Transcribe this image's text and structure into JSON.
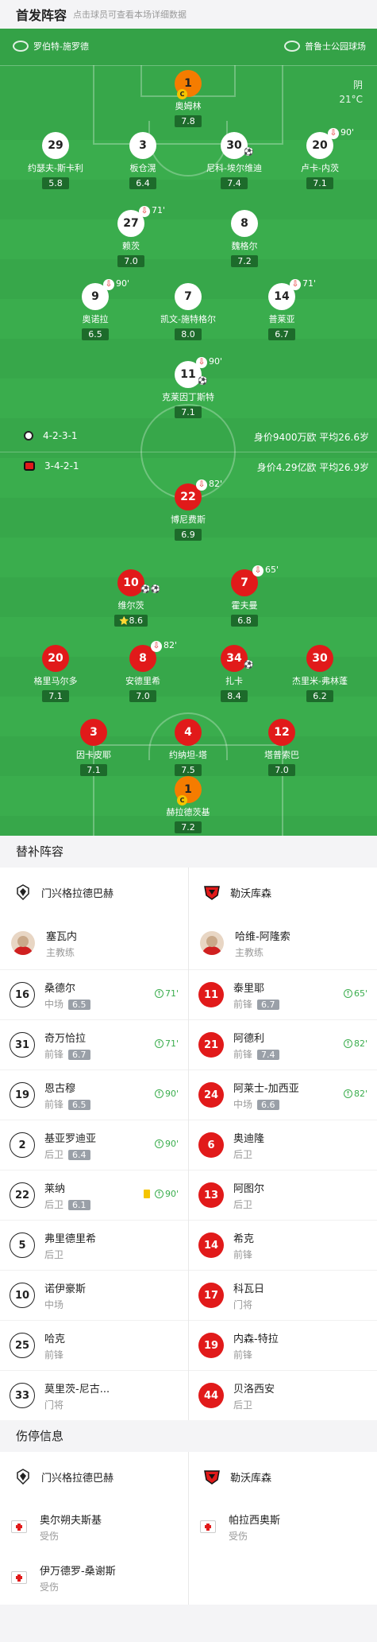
{
  "header": {
    "title": "首发阵容",
    "hint": "点击球员可查看本场详细数据"
  },
  "pitch": {
    "home_team": "罗伯特-施罗德",
    "venue": "普鲁士公园球场",
    "weather": "阴",
    "temperature": "21°C",
    "home_formation": "4-2-3-1",
    "home_info": "身价9400万欧 平均26.6岁",
    "away_formation": "3-4-2-1",
    "away_info": "身价4.29亿欧 平均26.9岁"
  },
  "players": [
    {
      "num": "1",
      "name": "奥姆林",
      "rating": "7.8",
      "style": "gk",
      "captain": "C"
    },
    {
      "num": "29",
      "name": "约瑟夫-斯卡利",
      "rating": "5.8",
      "style": "w"
    },
    {
      "num": "3",
      "name": "板仓滉",
      "rating": "6.4",
      "style": "w"
    },
    {
      "num": "30",
      "name": "尼科-埃尔维迪",
      "rating": "7.4",
      "style": "w",
      "ball": "⚽"
    },
    {
      "num": "20",
      "name": "卢卡-内茨",
      "rating": "7.1",
      "style": "w",
      "sub": "90'"
    },
    {
      "num": "27",
      "name": "赖茨",
      "rating": "7.0",
      "style": "w",
      "sub": "71'"
    },
    {
      "num": "8",
      "name": "魏格尔",
      "rating": "7.2",
      "style": "w"
    },
    {
      "num": "9",
      "name": "奥诺拉",
      "rating": "6.5",
      "style": "w",
      "sub": "90'"
    },
    {
      "num": "7",
      "name": "凯文-施特格尔",
      "rating": "8.0",
      "style": "w"
    },
    {
      "num": "14",
      "name": "普莱亚",
      "rating": "6.7",
      "style": "w",
      "sub": "71'"
    },
    {
      "num": "11",
      "name": "克莱因丁斯特",
      "rating": "7.1",
      "style": "w",
      "sub": "90'",
      "ball": "⚽"
    },
    {
      "num": "22",
      "name": "博尼费斯",
      "rating": "6.9",
      "style": "r",
      "sub": "82'"
    },
    {
      "num": "10",
      "name": "维尔茨",
      "rating": "8.6",
      "style": "r",
      "ball": "⚽⚽",
      "star": "⭐"
    },
    {
      "num": "7",
      "name": "霍夫曼",
      "rating": "6.8",
      "style": "r",
      "sub": "65'"
    },
    {
      "num": "20",
      "name": "格里马尔多",
      "rating": "7.1",
      "style": "r"
    },
    {
      "num": "8",
      "name": "安德里希",
      "rating": "7.0",
      "style": "r",
      "sub": "82'"
    },
    {
      "num": "34",
      "name": "扎卡",
      "rating": "8.4",
      "style": "r",
      "ball": "⚽"
    },
    {
      "num": "30",
      "name": "杰里米-弗林蓬",
      "rating": "6.2",
      "style": "r"
    },
    {
      "num": "3",
      "name": "因卡皮耶",
      "rating": "7.1",
      "style": "r"
    },
    {
      "num": "4",
      "name": "约纳坦-塔",
      "rating": "7.5",
      "style": "r"
    },
    {
      "num": "12",
      "name": "塔普索巴",
      "rating": "7.0",
      "style": "r"
    },
    {
      "num": "1",
      "name": "赫拉德茨基",
      "rating": "7.2",
      "style": "gk",
      "captain": "C"
    }
  ],
  "subs": {
    "title": "替补阵容",
    "home": {
      "team": "门兴格拉德巴赫",
      "coach": {
        "name": "塞瓦内",
        "role": "主教练"
      },
      "players": [
        {
          "num": "16",
          "name": "桑德尔",
          "pos": "中场",
          "rating": "6.5",
          "in": "71'"
        },
        {
          "num": "31",
          "name": "奇万恰拉",
          "pos": "前锋",
          "rating": "6.7",
          "in": "71'"
        },
        {
          "num": "19",
          "name": "恩古穆",
          "pos": "前锋",
          "rating": "6.5",
          "in": "90'"
        },
        {
          "num": "2",
          "name": "基亚罗迪亚",
          "pos": "后卫",
          "rating": "6.4",
          "in": "90'"
        },
        {
          "num": "22",
          "name": "莱纳",
          "pos": "后卫",
          "rating": "6.1",
          "in": "90'",
          "yellow": true
        },
        {
          "num": "5",
          "name": "弗里德里希",
          "pos": "后卫"
        },
        {
          "num": "10",
          "name": "诺伊豪斯",
          "pos": "中场"
        },
        {
          "num": "25",
          "name": "哈克",
          "pos": "前锋"
        },
        {
          "num": "33",
          "name": "莫里茨-尼古...",
          "pos": "门将"
        }
      ]
    },
    "away": {
      "team": "勒沃库森",
      "coach": {
        "name": "哈维-阿隆索",
        "role": "主教练"
      },
      "players": [
        {
          "num": "11",
          "name": "泰里耶",
          "pos": "前锋",
          "rating": "6.7",
          "in": "65'"
        },
        {
          "num": "21",
          "name": "阿德利",
          "pos": "前锋",
          "rating": "7.4",
          "in": "82'"
        },
        {
          "num": "24",
          "name": "阿莱士-加西亚",
          "pos": "中场",
          "rating": "6.6",
          "in": "82'"
        },
        {
          "num": "6",
          "name": "奥迪隆",
          "pos": "后卫"
        },
        {
          "num": "13",
          "name": "阿图尔",
          "pos": "后卫"
        },
        {
          "num": "14",
          "name": "希克",
          "pos": "前锋"
        },
        {
          "num": "17",
          "name": "科瓦日",
          "pos": "门将"
        },
        {
          "num": "19",
          "name": "内森-特拉",
          "pos": "前锋"
        },
        {
          "num": "44",
          "name": "贝洛西安",
          "pos": "后卫"
        }
      ]
    }
  },
  "injuries": {
    "title": "伤停信息",
    "home": {
      "team": "门兴格拉德巴赫",
      "players": [
        {
          "name": "奥尔朔夫斯基",
          "status": "受伤"
        },
        {
          "name": "伊万德罗-桑谢斯",
          "status": "受伤"
        }
      ]
    },
    "away": {
      "team": "勒沃库森",
      "players": [
        {
          "name": "帕拉西奥斯",
          "status": "受伤"
        }
      ]
    }
  },
  "colors": {
    "pitch": "#37a74a",
    "home_disc": "#ffffff",
    "away_disc": "#e11a1a",
    "gk_disc": "#f57c00"
  }
}
